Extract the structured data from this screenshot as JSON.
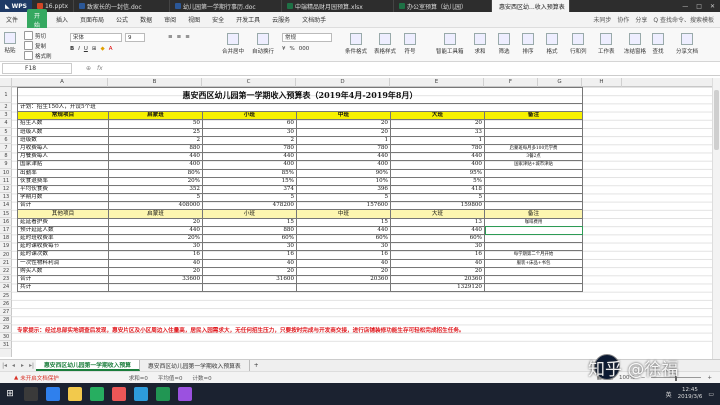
{
  "tabs": {
    "brand": "WPS",
    "items": [
      {
        "label": "16.pptx",
        "color": "#d24726"
      },
      {
        "label": "致家长的一封信.doc",
        "color": "#2b5797"
      },
      {
        "label": "幼儿园第一学期行事历.doc",
        "color": "#2b5797"
      },
      {
        "label": "中端精品财月园预算.xlsx",
        "color": "#1e7145"
      },
      {
        "label": "办公室预算（幼儿园）",
        "color": "#1e7145"
      },
      {
        "label": "惠安西区幼...收入预算表",
        "color": "#1e7145"
      }
    ]
  },
  "menu": {
    "file": "文件",
    "start": "开始",
    "items": [
      "插入",
      "页面布局",
      "公式",
      "数据",
      "审阅",
      "视图",
      "安全",
      "开发工具",
      "云服务",
      "文档助手"
    ],
    "sync": "未同步",
    "collab": "协作",
    "share": "分享",
    "search": "Q 查找命令、搜索模板"
  },
  "ribbon": {
    "paste": "粘贴",
    "cut": "剪切",
    "copy": "复制",
    "format_painter": "格式刷",
    "font": "宋体",
    "size": "9",
    "merge": "合并居中",
    "wrap": "自动换行",
    "numfmt": "常规",
    "cond": "条件格式",
    "table_style": "表格样式",
    "symbol": "符号",
    "smart": "智能工具箱",
    "sum": "求和",
    "filter": "筛选",
    "sort": "排序",
    "format": "格式",
    "rowcol": "行和列",
    "sheet": "工作表",
    "freeze": "冻结窗格",
    "find": "查找",
    "share_doc": "分享文档"
  },
  "formula": {
    "cell": "F18",
    "fx": "fx"
  },
  "columns": [
    "A",
    "B",
    "C",
    "D",
    "E",
    "F",
    "G",
    "H"
  ],
  "rows": [
    "1",
    "2",
    "3",
    "4",
    "5",
    "6",
    "7",
    "8",
    "9",
    "10",
    "11",
    "12",
    "13",
    "14",
    "15",
    "16",
    "17",
    "18",
    "19",
    "20",
    "21",
    "22",
    "23",
    "24",
    "25",
    "26",
    "27",
    "28",
    "29",
    "30",
    "31"
  ],
  "sheet": {
    "title": "惠安西区幼儿园第一学期收入预算表（2019年4月-2019年8月）",
    "plan": "计划：招生150人，开设5个班",
    "header1": [
      "常规项目",
      "启蒙班",
      "小班",
      "中班",
      "大班",
      "备注"
    ],
    "rows1": [
      [
        "招生人数",
        "50",
        "60",
        "20",
        "20",
        ""
      ],
      [
        "班级人数",
        "25",
        "30",
        "20",
        "33",
        ""
      ],
      [
        "班级数",
        "2",
        "2",
        "1",
        "1",
        ""
      ],
      [
        "月收费每人",
        "880",
        "780",
        "780",
        "780",
        "启蒙班每月多100元学费"
      ],
      [
        "月餐费每人",
        "440",
        "440",
        "440",
        "440",
        "3餐2点"
      ],
      [
        "国家津贴",
        "400",
        "400",
        "400",
        "400",
        "国家津贴+城市津贴"
      ],
      [
        "出勤率",
        "80%",
        "85%",
        "90%",
        "95%",
        ""
      ],
      [
        "伙食退费率",
        "20%",
        "15%",
        "10%",
        "5%",
        ""
      ],
      [
        "平均伙食费",
        "352",
        "374",
        "396",
        "418",
        ""
      ],
      [
        "学期月数",
        "5",
        "5",
        "5",
        "5",
        ""
      ],
      [
        "合计",
        "408000",
        "478200",
        "157600",
        "159800",
        ""
      ]
    ],
    "header2": [
      "其他项目",
      "启蒙班",
      "小班",
      "中班",
      "大班",
      "备注"
    ],
    "rows2": [
      [
        "延延看护费",
        "20",
        "15",
        "15",
        "13",
        "咖啡费用"
      ],
      [
        "预计延延人数",
        "440",
        "880",
        "440",
        "440",
        ""
      ],
      [
        "延时班收费率",
        "20%",
        "60%",
        "60%",
        "60%",
        ""
      ],
      [
        "延时课收费每节",
        "30",
        "30",
        "30",
        "30",
        ""
      ],
      [
        "延时课次数",
        "16",
        "16",
        "16",
        "16",
        "每学期第二个月开始"
      ],
      [
        "一次性物料利润",
        "40",
        "40",
        "40",
        "40",
        "服装+床品+书包"
      ],
      [
        "购买人数",
        "20",
        "20",
        "20",
        "20",
        ""
      ],
      [
        "合计",
        "33600",
        "31600",
        "20360",
        "20360",
        ""
      ],
      [
        "共计",
        "",
        "",
        "",
        "1329120",
        ""
      ]
    ],
    "warning": "专家提示：经过总部实地调查后发现，惠安片区及小区周边入住量高，居民入园需求大，无任何招生压力，只要按时完成与开发商交接，进行店铺装修功能生存可轻松完成招生任务。"
  },
  "sheet_tabs": [
    "惠安西区幼儿园第一学期收入预算",
    "惠安西区幼儿园第一学期收入预算表"
  ],
  "status": {
    "protect": "未开启文档保护",
    "sum": "求和=0",
    "avg": "平均值=0",
    "count": "计数=0",
    "zoom": "100%"
  },
  "taskbar": {
    "lang": "英",
    "time": "12:45",
    "date": "2019/3/6"
  },
  "watermark": "知乎 @徐福"
}
